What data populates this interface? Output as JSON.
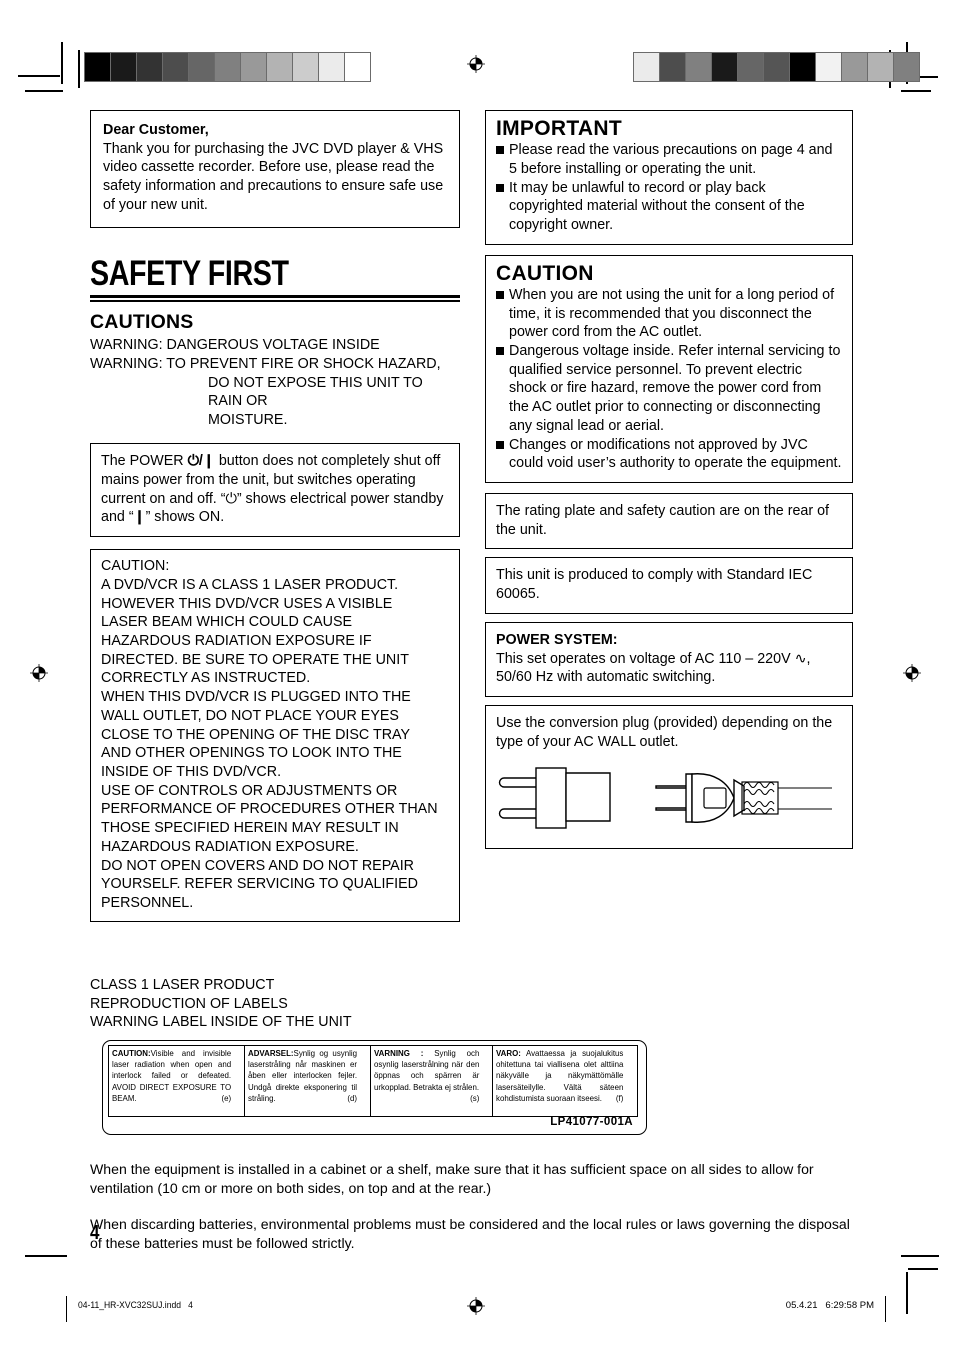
{
  "page": {
    "number": "4",
    "footer_left": "04-11_HR-XVC32SUJ.indd   4",
    "footer_right": "05.4.21   6:29:58 PM"
  },
  "dear_customer": {
    "heading": "Dear Customer,",
    "body": "Thank you for purchasing the JVC DVD player & VHS video cassette recorder. Before use, please read the safety information and precautions to ensure safe use of your new unit."
  },
  "safety_first": {
    "title": "SAFETY FIRST",
    "cautions_heading": "CAUTIONS",
    "warning_1": "WARNING: DANGEROUS VOLTAGE INSIDE",
    "warning_2_line1": "WARNING: TO PREVENT FIRE OR SHOCK HAZARD,",
    "warning_2_line2": "DO NOT EXPOSE THIS UNIT TO RAIN OR",
    "warning_2_line3": "MOISTURE."
  },
  "power_button_box": {
    "text_part1": "The POWER ",
    "symbol": "⏻/❙",
    "text_part2": " button does not completely shut off mains power from the unit, but switches operating current on and off. “⏻” shows electrical power standby and “❙” shows ON."
  },
  "laser_caution_box": {
    "lines": [
      "CAUTION:",
      "A DVD/VCR IS A CLASS 1 LASER PRODUCT.",
      "HOWEVER THIS DVD/VCR USES A VISIBLE",
      "LASER BEAM WHICH COULD CAUSE",
      "HAZARDOUS RADIATION EXPOSURE IF",
      "DIRECTED. BE SURE TO OPERATE THE UNIT",
      "CORRECTLY AS INSTRUCTED.",
      "WHEN THIS DVD/VCR IS PLUGGED INTO THE",
      "WALL OUTLET, DO NOT PLACE YOUR EYES",
      "CLOSE TO THE OPENING OF THE DISC TRAY",
      "AND OTHER OPENINGS TO LOOK INTO THE",
      "INSIDE OF THIS DVD/VCR.",
      "USE OF CONTROLS OR ADJUSTMENTS OR",
      "PERFORMANCE OF PROCEDURES OTHER THAN",
      "THOSE SPECIFIED HEREIN MAY RESULT IN",
      "HAZARDOUS RADIATION EXPOSURE.",
      "DO NOT OPEN COVERS AND DO NOT REPAIR",
      "YOURSELF. REFER SERVICING TO QUALIFIED",
      "PERSONNEL."
    ]
  },
  "class_text": {
    "line1": "CLASS 1 LASER PRODUCT",
    "line2": "REPRODUCTION OF LABELS",
    "line3": "WARNING LABEL INSIDE OF THE UNIT"
  },
  "laser_label": {
    "code": "LP41077-001A",
    "panels": [
      {
        "heading": "CAUTION:",
        "body": "Visible and invisible laser radiation when open and interlock failed or defeated. AVOID DIRECT EXPOSURE TO BEAM.",
        "lang_code": "(e)"
      },
      {
        "heading": "ADVARSEL:",
        "body": "Synlig og usynlig laserstråling når maskinen er åben eller interlocken fejler. Undgå direkte eksponering til stråling.",
        "lang_code": "(d)"
      },
      {
        "heading": "VARNING :",
        "body": " Synlig och osynlig laserstrålning när den öppnas och spärren är urkopplad. Betrakta ej strålen.",
        "lang_code": "(s)"
      },
      {
        "heading": "VARO:",
        "body": " Avattaessa ja suojalukitus ohitettuna tai viallisena olet alttiina näkyvälle ja näkymättömälle lasersäteilylle. Vältä säteen kohdistumista suoraan itseesi.",
        "lang_code": "(f)"
      }
    ]
  },
  "important_box": {
    "heading": "IMPORTANT",
    "items": [
      "Please read the various precautions on page 4 and 5 before installing or operating the unit.",
      "It may be unlawful to record or play back copyrighted material without the consent of the copyright owner."
    ]
  },
  "caution_box": {
    "heading": "CAUTION",
    "items": [
      "When you are not using the unit for a long period of time, it is recommended that you disconnect the power cord from the AC outlet.",
      "Dangerous voltage inside. Refer internal servicing to qualified service personnel. To prevent electric shock or fire hazard, remove the power cord from the AC outlet prior to connecting or disconnecting any signal lead or aerial.",
      "Changes or modifications not approved by JVC could void user’s authority to operate the equipment."
    ]
  },
  "rating_plate_box": {
    "text": "The rating plate and safety caution are on the rear of the unit."
  },
  "iec_box": {
    "text": "This unit is produced to comply with Standard IEC 60065."
  },
  "power_system_box": {
    "heading": "POWER SYSTEM:",
    "text": "This set operates on voltage of AC 110 – 220V ∿, 50/60 Hz with automatic switching."
  },
  "conversion_plug_box": {
    "text": "Use the conversion plug (provided) depending on the type of your AC WALL outlet."
  },
  "bottom_paragraphs": {
    "para1": "When the equipment is installed in a cabinet or a shelf, make sure that it has sufficient space on all sides to allow for ventilation (10 cm or more on both sides, on top and at the rear.)",
    "para2": "When discarding batteries, environmental problems must be considered and the local rules or laws governing the disposal of these batteries must be followed strictly."
  },
  "print_marks": {
    "step_wedge_left": [
      "#000000",
      "#1a1a1a",
      "#333333",
      "#4d4d4d",
      "#666666",
      "#808080",
      "#999999",
      "#b3b3b3",
      "#cccccc",
      "#ebebeb",
      "#ffffff"
    ],
    "step_wedge_right": [
      "#ebebeb",
      "#4d4d4d",
      "#808080",
      "#1a1a1a",
      "#666666",
      "#555555",
      "#000000",
      "#f2f2f2",
      "#999999",
      "#b3b3b3",
      "#808080"
    ]
  }
}
